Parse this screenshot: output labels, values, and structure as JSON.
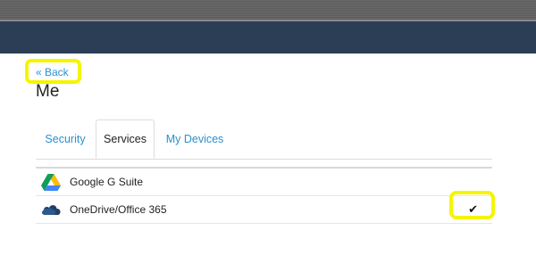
{
  "nav": {
    "back_label": "« Back"
  },
  "page": {
    "title": "Me"
  },
  "tabs": [
    {
      "label": "Security",
      "active": false
    },
    {
      "label": "Services",
      "active": true
    },
    {
      "label": "My Devices",
      "active": false
    }
  ],
  "services": [
    {
      "name": "Google G Suite",
      "icon": "google-drive-icon",
      "checked": false
    },
    {
      "name": "OneDrive/Office 365",
      "icon": "onedrive-cloud-icon",
      "checked": true
    }
  ],
  "colors": {
    "header": "#2c3e55",
    "link": "#2a8fd0",
    "highlight": "#f5f500"
  }
}
